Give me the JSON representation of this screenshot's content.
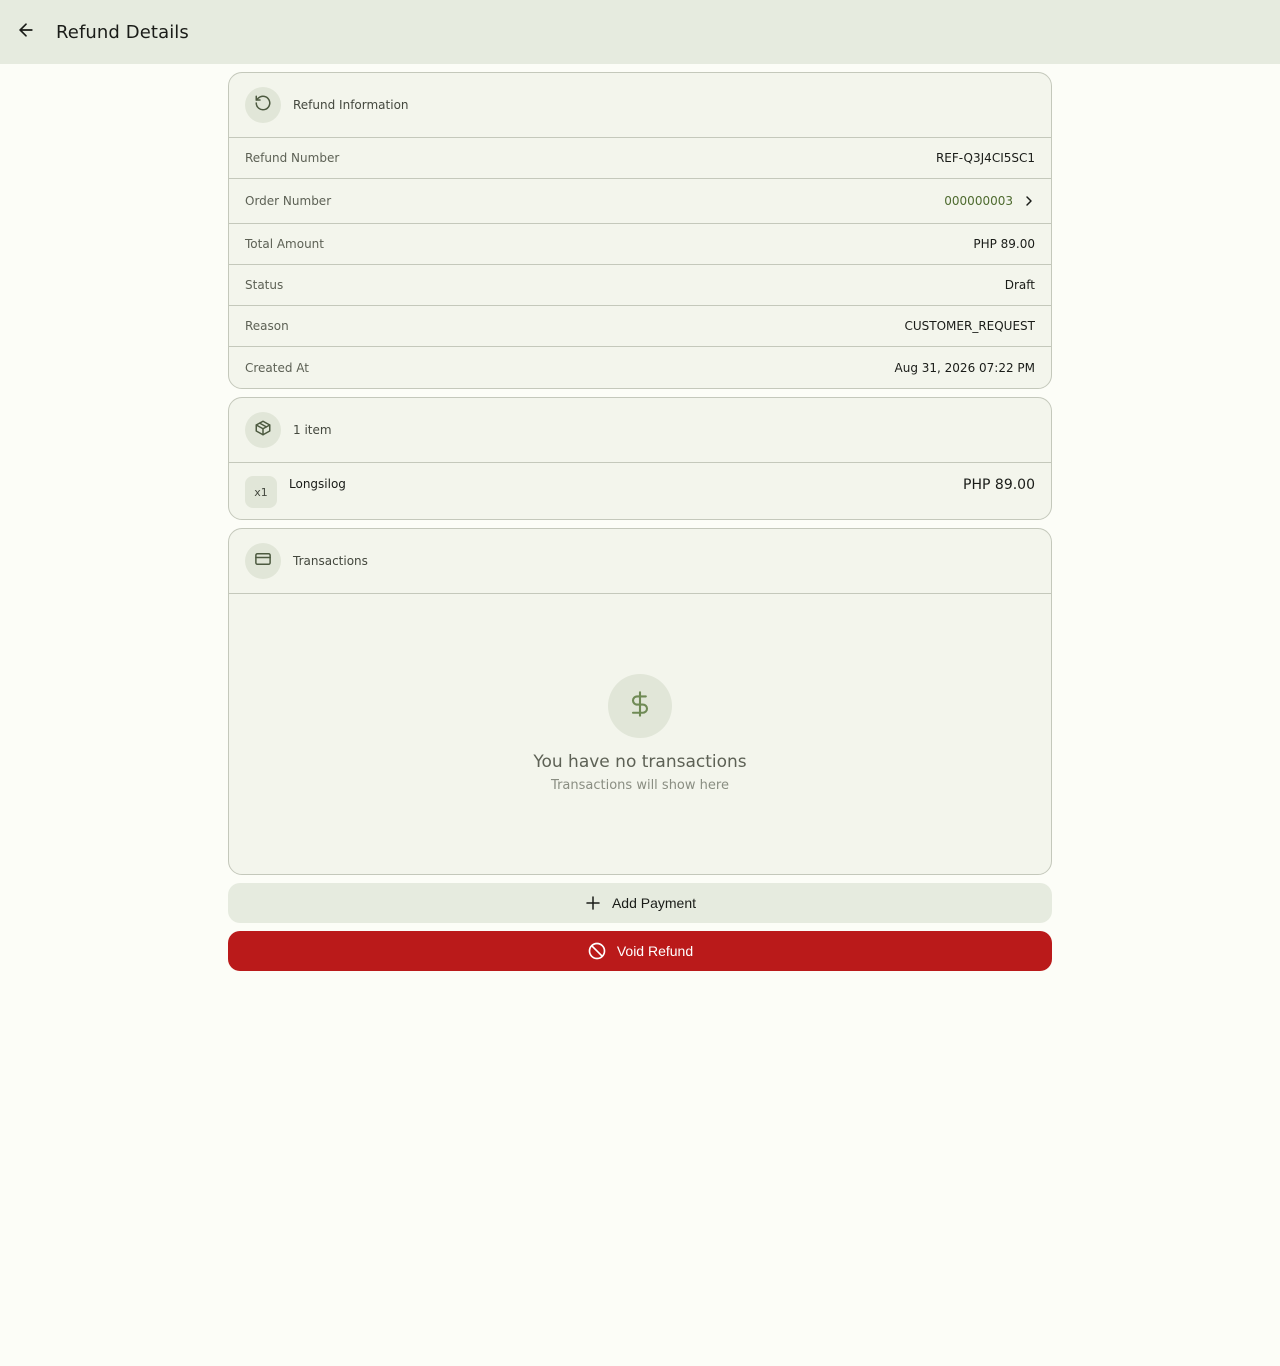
{
  "appbar": {
    "title": "Refund Details",
    "back_icon": "arrow-left-icon"
  },
  "refund_info": {
    "header_title": "Refund Information",
    "header_icon": "refresh-icon",
    "rows": [
      {
        "label": "Refund Number",
        "value": "REF-Q3J4CI5SC1"
      },
      {
        "label": "Order Number",
        "value": "000000003"
      },
      {
        "label": "Total Amount",
        "value": "PHP 89.00"
      },
      {
        "label": "Status",
        "value": "Draft"
      },
      {
        "label": "Reason",
        "value": "CUSTOMER_REQUEST"
      },
      {
        "label": "Created At",
        "value": "Aug 31, 2026 07:22 PM"
      }
    ]
  },
  "items": {
    "header_title": "1 item",
    "header_icon": "package-icon",
    "list": [
      {
        "qty": "x1",
        "name": "Longsilog",
        "price": "PHP 89.00"
      }
    ]
  },
  "transactions": {
    "header_title": "Transactions",
    "header_icon": "credit-card-icon",
    "empty_icon": "dollar-icon",
    "empty_title": "You have no transactions",
    "empty_subtitle": "Transactions will show here"
  },
  "actions": {
    "add_payment_label": "Add Payment",
    "void_refund_label": "Void Refund"
  },
  "colors": {
    "accent": "#4d6a2e",
    "danger": "#ba1a1a",
    "surface": "#f3f5ec",
    "appbar": "#e6ebdf"
  }
}
